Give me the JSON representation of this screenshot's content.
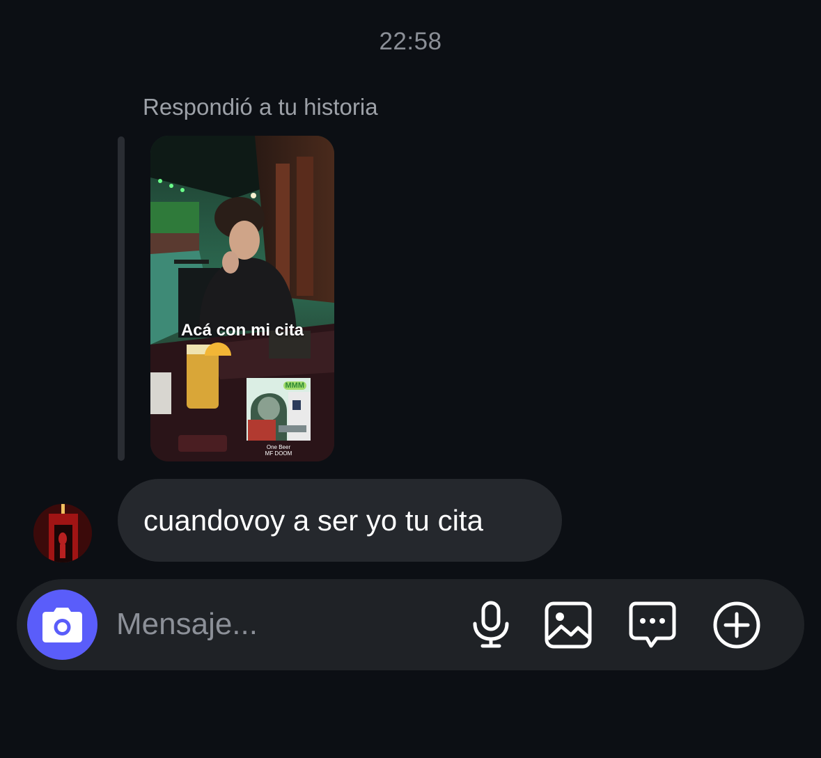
{
  "conversation": {
    "timestamp": "22:58",
    "reply_label": "Respondió a tu historia"
  },
  "story": {
    "caption": "Acá con mi cita",
    "music_sticker": {
      "album_word": "MMM",
      "title": "One Beer",
      "artist": "MF DOOM"
    }
  },
  "message": {
    "text": "cuandovoy a ser yo tu cita"
  },
  "composer": {
    "placeholder": "Mensaje...",
    "icons": [
      "camera-icon",
      "microphone-icon",
      "gallery-icon",
      "sticker-icon",
      "plus-icon"
    ]
  },
  "colors": {
    "background": "#0c0f14",
    "bubble": "#25282d",
    "composer": "#1f2226",
    "camera_accent": "#5a5dfa",
    "muted_text": "#8b8f97"
  }
}
